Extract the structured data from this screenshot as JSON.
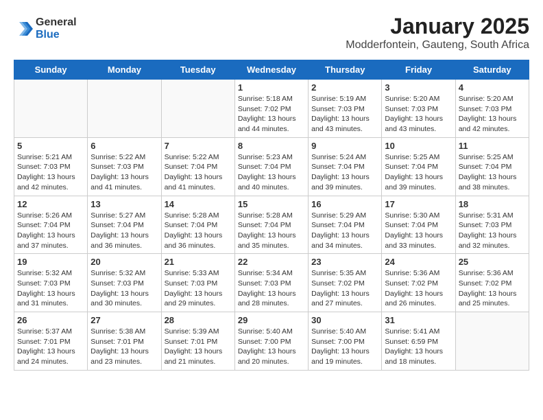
{
  "logo": {
    "general": "General",
    "blue": "Blue"
  },
  "header": {
    "title": "January 2025",
    "subtitle": "Modderfontein, Gauteng, South Africa"
  },
  "weekdays": [
    "Sunday",
    "Monday",
    "Tuesday",
    "Wednesday",
    "Thursday",
    "Friday",
    "Saturday"
  ],
  "weeks": [
    [
      {
        "day": "",
        "info": ""
      },
      {
        "day": "",
        "info": ""
      },
      {
        "day": "",
        "info": ""
      },
      {
        "day": "1",
        "info": "Sunrise: 5:18 AM\nSunset: 7:02 PM\nDaylight: 13 hours\nand 44 minutes."
      },
      {
        "day": "2",
        "info": "Sunrise: 5:19 AM\nSunset: 7:03 PM\nDaylight: 13 hours\nand 43 minutes."
      },
      {
        "day": "3",
        "info": "Sunrise: 5:20 AM\nSunset: 7:03 PM\nDaylight: 13 hours\nand 43 minutes."
      },
      {
        "day": "4",
        "info": "Sunrise: 5:20 AM\nSunset: 7:03 PM\nDaylight: 13 hours\nand 42 minutes."
      }
    ],
    [
      {
        "day": "5",
        "info": "Sunrise: 5:21 AM\nSunset: 7:03 PM\nDaylight: 13 hours\nand 42 minutes."
      },
      {
        "day": "6",
        "info": "Sunrise: 5:22 AM\nSunset: 7:03 PM\nDaylight: 13 hours\nand 41 minutes."
      },
      {
        "day": "7",
        "info": "Sunrise: 5:22 AM\nSunset: 7:04 PM\nDaylight: 13 hours\nand 41 minutes."
      },
      {
        "day": "8",
        "info": "Sunrise: 5:23 AM\nSunset: 7:04 PM\nDaylight: 13 hours\nand 40 minutes."
      },
      {
        "day": "9",
        "info": "Sunrise: 5:24 AM\nSunset: 7:04 PM\nDaylight: 13 hours\nand 39 minutes."
      },
      {
        "day": "10",
        "info": "Sunrise: 5:25 AM\nSunset: 7:04 PM\nDaylight: 13 hours\nand 39 minutes."
      },
      {
        "day": "11",
        "info": "Sunrise: 5:25 AM\nSunset: 7:04 PM\nDaylight: 13 hours\nand 38 minutes."
      }
    ],
    [
      {
        "day": "12",
        "info": "Sunrise: 5:26 AM\nSunset: 7:04 PM\nDaylight: 13 hours\nand 37 minutes."
      },
      {
        "day": "13",
        "info": "Sunrise: 5:27 AM\nSunset: 7:04 PM\nDaylight: 13 hours\nand 36 minutes."
      },
      {
        "day": "14",
        "info": "Sunrise: 5:28 AM\nSunset: 7:04 PM\nDaylight: 13 hours\nand 36 minutes."
      },
      {
        "day": "15",
        "info": "Sunrise: 5:28 AM\nSunset: 7:04 PM\nDaylight: 13 hours\nand 35 minutes."
      },
      {
        "day": "16",
        "info": "Sunrise: 5:29 AM\nSunset: 7:04 PM\nDaylight: 13 hours\nand 34 minutes."
      },
      {
        "day": "17",
        "info": "Sunrise: 5:30 AM\nSunset: 7:04 PM\nDaylight: 13 hours\nand 33 minutes."
      },
      {
        "day": "18",
        "info": "Sunrise: 5:31 AM\nSunset: 7:03 PM\nDaylight: 13 hours\nand 32 minutes."
      }
    ],
    [
      {
        "day": "19",
        "info": "Sunrise: 5:32 AM\nSunset: 7:03 PM\nDaylight: 13 hours\nand 31 minutes."
      },
      {
        "day": "20",
        "info": "Sunrise: 5:32 AM\nSunset: 7:03 PM\nDaylight: 13 hours\nand 30 minutes."
      },
      {
        "day": "21",
        "info": "Sunrise: 5:33 AM\nSunset: 7:03 PM\nDaylight: 13 hours\nand 29 minutes."
      },
      {
        "day": "22",
        "info": "Sunrise: 5:34 AM\nSunset: 7:03 PM\nDaylight: 13 hours\nand 28 minutes."
      },
      {
        "day": "23",
        "info": "Sunrise: 5:35 AM\nSunset: 7:02 PM\nDaylight: 13 hours\nand 27 minutes."
      },
      {
        "day": "24",
        "info": "Sunrise: 5:36 AM\nSunset: 7:02 PM\nDaylight: 13 hours\nand 26 minutes."
      },
      {
        "day": "25",
        "info": "Sunrise: 5:36 AM\nSunset: 7:02 PM\nDaylight: 13 hours\nand 25 minutes."
      }
    ],
    [
      {
        "day": "26",
        "info": "Sunrise: 5:37 AM\nSunset: 7:01 PM\nDaylight: 13 hours\nand 24 minutes."
      },
      {
        "day": "27",
        "info": "Sunrise: 5:38 AM\nSunset: 7:01 PM\nDaylight: 13 hours\nand 23 minutes."
      },
      {
        "day": "28",
        "info": "Sunrise: 5:39 AM\nSunset: 7:01 PM\nDaylight: 13 hours\nand 21 minutes."
      },
      {
        "day": "29",
        "info": "Sunrise: 5:40 AM\nSunset: 7:00 PM\nDaylight: 13 hours\nand 20 minutes."
      },
      {
        "day": "30",
        "info": "Sunrise: 5:40 AM\nSunset: 7:00 PM\nDaylight: 13 hours\nand 19 minutes."
      },
      {
        "day": "31",
        "info": "Sunrise: 5:41 AM\nSunset: 6:59 PM\nDaylight: 13 hours\nand 18 minutes."
      },
      {
        "day": "",
        "info": ""
      }
    ]
  ]
}
